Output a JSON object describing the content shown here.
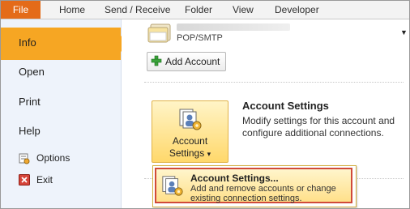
{
  "ribbon": {
    "file_tab": "File",
    "tabs": [
      "Home",
      "Send / Receive",
      "Folder",
      "View",
      "Developer"
    ],
    "file_tab_color": "#e46b19"
  },
  "backstage_nav": {
    "items": [
      {
        "label": "Info",
        "selected": true
      },
      {
        "label": "Open"
      },
      {
        "label": "Print"
      },
      {
        "label": "Help"
      },
      {
        "label": "Options",
        "icon": "options-icon"
      },
      {
        "label": "Exit",
        "icon": "exit-icon"
      }
    ],
    "selected_color": "#f6a623"
  },
  "account": {
    "type_label": "POP/SMTP",
    "icon": "folder-icon",
    "caret_icon": "dropdown-caret-icon",
    "add_account_label": "Add Account",
    "add_icon": "green-plus-icon"
  },
  "account_settings": {
    "button_line1": "Account",
    "button_line2": "Settings",
    "button_caret": "▾",
    "title": "Account Settings",
    "description": "Modify settings for this account and configure additional connections.",
    "icon": "account-settings-icon"
  },
  "dropdown_menu": {
    "item_title": "Account Settings...",
    "item_description": "Add and remove accounts or change existing connection settings.",
    "highlight_border_color": "#d04a3a"
  }
}
